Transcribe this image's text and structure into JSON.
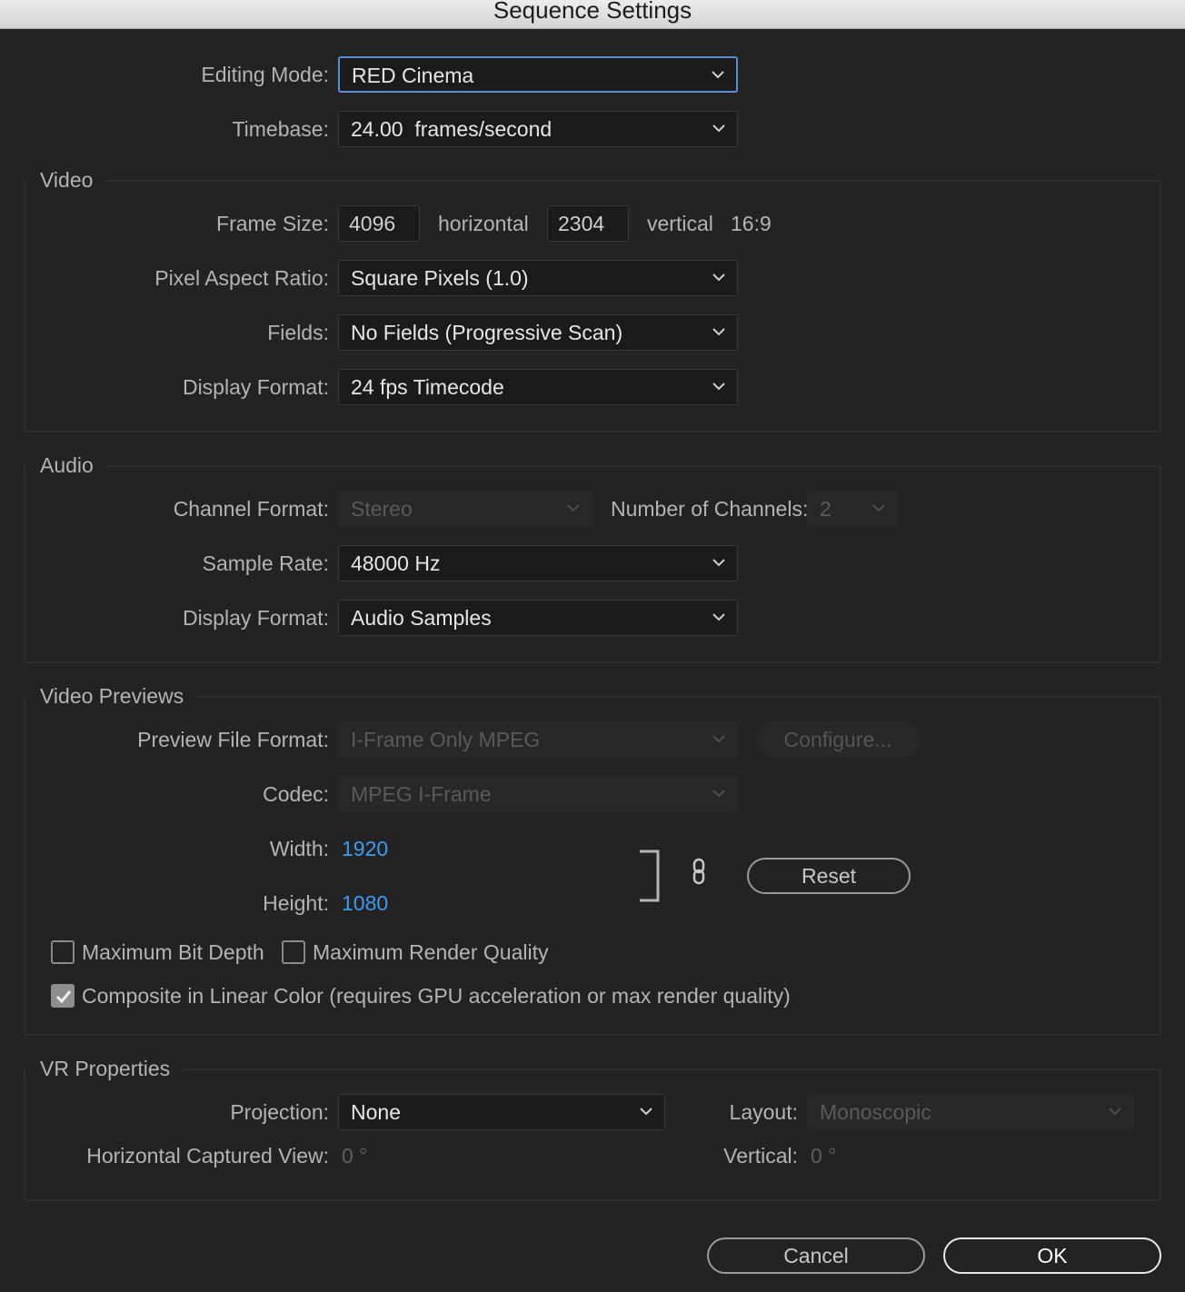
{
  "window": {
    "title": "Sequence Settings"
  },
  "general": {
    "editing_mode_label": "Editing Mode:",
    "editing_mode_value": "RED Cinema",
    "timebase_label": "Timebase:",
    "timebase_value": "24.00  frames/second"
  },
  "video": {
    "legend": "Video",
    "frame_size_label": "Frame Size:",
    "frame_width": "4096",
    "horizontal_label": "horizontal",
    "frame_height": "2304",
    "vertical_label": "vertical",
    "aspect": "16:9",
    "par_label": "Pixel Aspect Ratio:",
    "par_value": "Square Pixels (1.0)",
    "fields_label": "Fields:",
    "fields_value": "No Fields (Progressive Scan)",
    "display_format_label": "Display Format:",
    "display_format_value": "24 fps Timecode"
  },
  "audio": {
    "legend": "Audio",
    "channel_format_label": "Channel Format:",
    "channel_format_value": "Stereo",
    "num_channels_label": "Number of Channels:",
    "num_channels_value": "2",
    "sample_rate_label": "Sample Rate:",
    "sample_rate_value": "48000 Hz",
    "display_format_label": "Display Format:",
    "display_format_value": "Audio Samples"
  },
  "previews": {
    "legend": "Video Previews",
    "file_format_label": "Preview File Format:",
    "file_format_value": "I-Frame Only MPEG",
    "configure_label": "Configure...",
    "codec_label": "Codec:",
    "codec_value": "MPEG I-Frame",
    "width_label": "Width:",
    "width_value": "1920",
    "height_label": "Height:",
    "height_value": "1080",
    "reset_label": "Reset",
    "max_bit_depth_label": "Maximum Bit Depth",
    "max_bit_depth_checked": false,
    "max_render_quality_label": "Maximum Render Quality",
    "max_render_quality_checked": false,
    "linear_color_label": "Composite in Linear Color (requires GPU acceleration or max render quality)",
    "linear_color_checked": true
  },
  "vr": {
    "legend": "VR Properties",
    "projection_label": "Projection:",
    "projection_value": "None",
    "layout_label": "Layout:",
    "layout_value": "Monoscopic",
    "h_view_label": "Horizontal Captured View:",
    "h_view_value": "0 °",
    "vertical_label": "Vertical:",
    "vertical_value": "0 °"
  },
  "footer": {
    "cancel_label": "Cancel",
    "ok_label": "OK"
  },
  "colors": {
    "accent_blue": "#3d9cf0",
    "focus_ring": "#5b8ed6",
    "background": "#232323"
  }
}
